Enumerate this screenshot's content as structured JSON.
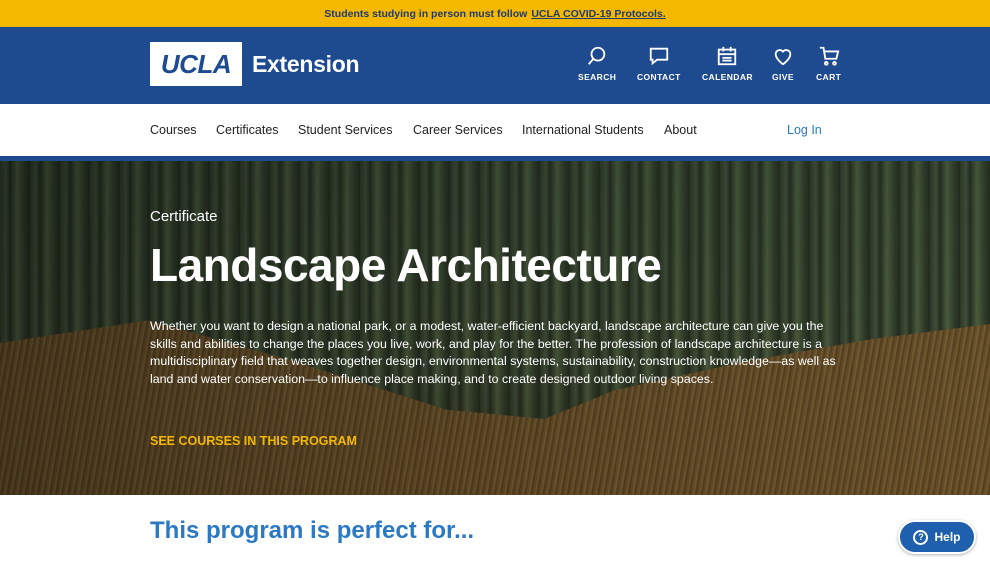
{
  "alert": {
    "text": "Students studying in person must follow",
    "link": "UCLA COVID-19 Protocols."
  },
  "header": {
    "logo_mark": "UCLA",
    "logo_text": "Extension",
    "utilities": [
      {
        "label": "SEARCH",
        "icon": "search-icon"
      },
      {
        "label": "CONTACT",
        "icon": "chat-icon"
      },
      {
        "label": "CALENDAR",
        "icon": "calendar-icon"
      },
      {
        "label": "GIVE",
        "icon": "heart-icon"
      },
      {
        "label": "CART",
        "icon": "cart-icon"
      }
    ]
  },
  "nav": {
    "items": [
      "Courses",
      "Certificates",
      "Student Services",
      "Career Services",
      "International Students",
      "About"
    ],
    "login": "Log In"
  },
  "hero": {
    "kicker": "Certificate",
    "title": "Landscape Architecture",
    "description": "Whether you want to design a national park, or a modest, water-efficient backyard, landscape architecture can give you the skills and abilities to change the places you live, work, and play for the better. The profession of landscape architecture is a multidisciplinary field that weaves together design, environmental systems, sustainability, construction knowledge—as well as land and water conservation—to influence place making, and to create designed outdoor living spaces.",
    "cta": "SEE COURSES IN THIS PROGRAM"
  },
  "section": {
    "heading": "This program is perfect for..."
  },
  "help": {
    "icon_glyph": "?",
    "label": "Help"
  },
  "colors": {
    "alert_bg": "#f5b800",
    "header_bg": "#1e4a8f",
    "accent_blue": "#2b79c2",
    "cta_gold": "#f5b800"
  }
}
